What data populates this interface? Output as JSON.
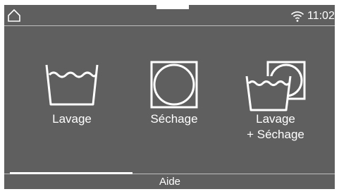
{
  "statusbar": {
    "home_icon": "home-icon",
    "wifi_icon": "wifi-icon",
    "time": "11:02"
  },
  "programs": [
    {
      "label": "Lavage",
      "icon": "wash-basin-icon"
    },
    {
      "label": "Séchage",
      "icon": "tumble-dry-icon"
    },
    {
      "label": "Lavage\n+ Séchage",
      "icon": "wash-and-dry-icon"
    }
  ],
  "footer": {
    "help_label": "Aide"
  },
  "colors": {
    "screen_background": "#5f5f5f",
    "foreground": "#ffffff",
    "divider": "#bdbdbd"
  }
}
